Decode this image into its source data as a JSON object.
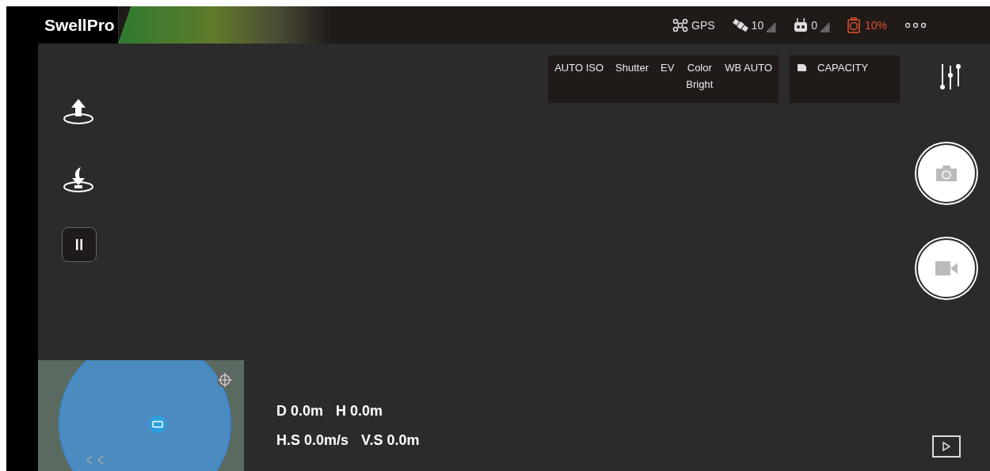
{
  "logo": "SwellPro",
  "status_bar": [
    {
      "kind": "gps",
      "text": "GPS"
    },
    {
      "kind": "satellite",
      "text": "10"
    },
    {
      "kind": "remote",
      "text": "0"
    },
    {
      "kind": "battery",
      "text": "10%",
      "low": true
    },
    {
      "kind": "more"
    }
  ],
  "camera_settings": [
    "AUTO ISO",
    "Shutter",
    "EV",
    "Color\nBright",
    "WB AUTO"
  ],
  "storage": {
    "label": "CAPACITY"
  },
  "left_controls": [
    {
      "kind": "takeoff"
    },
    {
      "kind": "return_home"
    },
    {
      "kind": "pause"
    }
  ],
  "telemetry": [
    [
      "D 0.0m",
      "H 0.0m"
    ],
    [
      "H.S 0.0m/s",
      "V.S 0.0m"
    ]
  ]
}
